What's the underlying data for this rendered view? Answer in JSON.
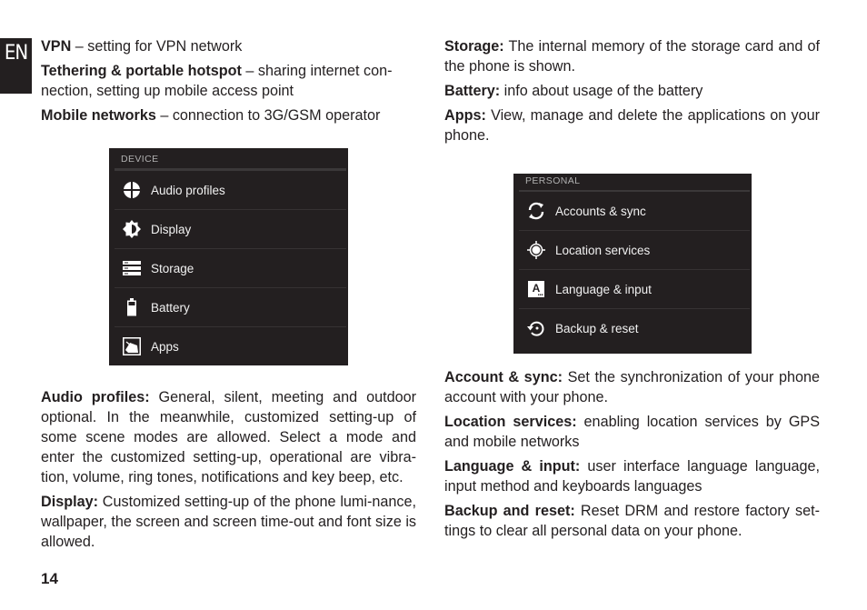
{
  "language_tab": "EN",
  "page_number": "14",
  "left_column": {
    "top_paragraphs": [
      {
        "term": "VPN",
        "text": " – setting for VPN network"
      },
      {
        "term": "Tethering & portable hotspot",
        "text": " – sharing internet con-nection, setting up mobile access point"
      },
      {
        "term": "Mobile networks",
        "text": " – connection to 3G/GSM operator"
      }
    ],
    "bottom_paragraphs": [
      {
        "term": "Audio profiles:",
        "text": " General, silent, meeting and outdoor optional. In the meanwhile, customized setting-up of some scene modes are allowed. Select a mode and enter the customized setting-up, operational are vibra-tion, volume, ring tones, notifications and key beep, etc."
      },
      {
        "term": "Display:",
        "text": " Customized setting-up of the phone lumi-nance, wallpaper, the screen and screen time-out and font size is allowed."
      }
    ]
  },
  "right_column": {
    "top_paragraphs": [
      {
        "term": "Storage:",
        "text": " The internal memory of the storage card and of the phone is shown."
      },
      {
        "term": "Battery:",
        "text": " info about usage of the battery"
      },
      {
        "term": "Apps:",
        "text": " View, manage and delete the applications on your phone."
      }
    ],
    "bottom_paragraphs": [
      {
        "term": "Account & sync:",
        "text": " Set the synchronization of your phone account with your phone."
      },
      {
        "term": "Location services:",
        "text": " enabling location services by GPS and mobile networks"
      },
      {
        "term": "Language & input:",
        "text": " user interface language language, input method and keyboards languages"
      },
      {
        "term": "Backup and reset:",
        "text": " Reset DRM and restore factory set-tings to clear all personal data on your phone."
      }
    ]
  },
  "device_panel": {
    "header": "DEVICE",
    "items": [
      {
        "label": "Audio profiles",
        "icon": "audio-profiles-icon"
      },
      {
        "label": "Display",
        "icon": "display-brightness-icon"
      },
      {
        "label": "Storage",
        "icon": "storage-icon"
      },
      {
        "label": "Battery",
        "icon": "battery-icon"
      },
      {
        "label": "Apps",
        "icon": "apps-icon"
      }
    ]
  },
  "personal_panel": {
    "header": "PERSONAL",
    "items": [
      {
        "label": "Accounts & sync",
        "icon": "sync-icon"
      },
      {
        "label": "Location services",
        "icon": "location-icon"
      },
      {
        "label": "Language & input",
        "icon": "language-icon"
      },
      {
        "label": "Backup & reset",
        "icon": "backup-restore-icon"
      }
    ]
  }
}
